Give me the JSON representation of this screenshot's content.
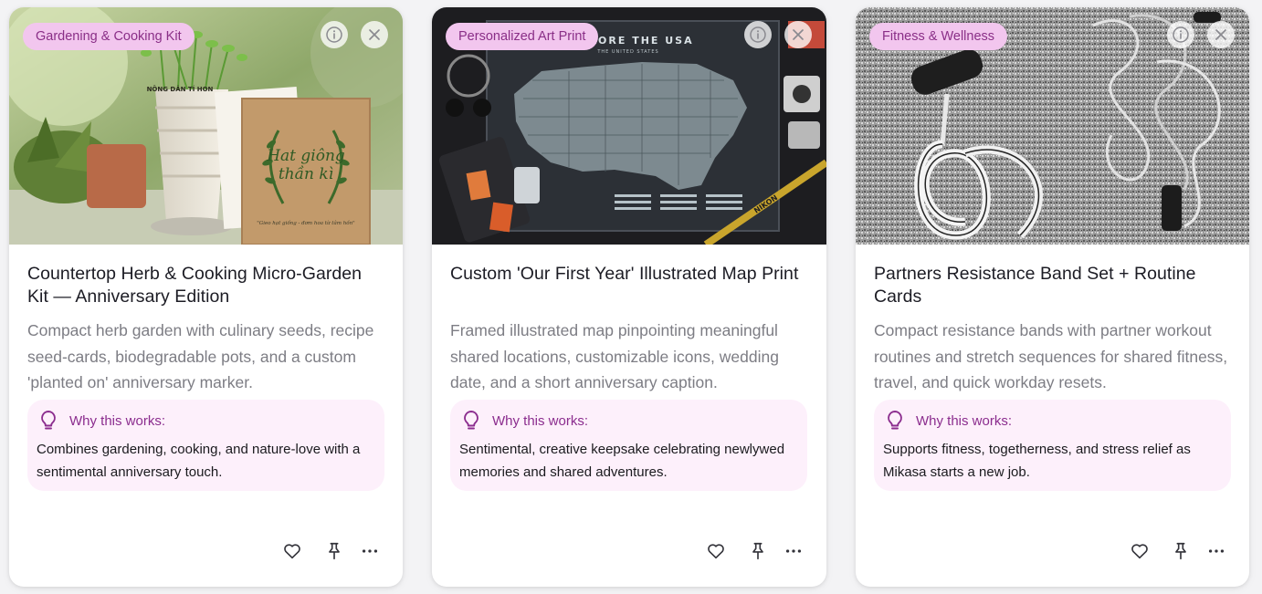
{
  "cards": [
    {
      "tag": "Gardening & Cooking Kit",
      "title": "Countertop Herb & Cooking Micro-Garden Kit — Anniversary Edition",
      "description": "Compact herb garden with culinary seeds, recipe seed-cards, biodegradable pots, and a custom 'planted on' anniversary marker.",
      "why_label": "Why this works:",
      "why_text": "Combines gardening, cooking, and nature-love with a sentimental anniversary touch.",
      "image_text": {
        "pot_label": "NÔNG DÂN TÍ HON",
        "packet_title_1": "Hat giông",
        "packet_title_2": "thần kì",
        "packet_caption": "\"Gieo hạt giống - đơm hoa từ tâm hồn\""
      }
    },
    {
      "tag": "Personalized Art Print",
      "title": "Custom 'Our First Year' Illustrated Map Print",
      "description": "Framed illustrated map pinpointing meaningful shared locations, customizable icons, wedding date, and a short anniversary caption.",
      "why_label": "Why this works:",
      "why_text": "Sentimental, creative keepsake celebrating newlywed memories and shared adventures.",
      "image_text": {
        "map_title": "EXPLORE THE USA",
        "map_subtitle": "THE UNITED STATES",
        "strap_text": "NIKON"
      }
    },
    {
      "tag": "Fitness & Wellness",
      "title": "Partners Resistance Band Set + Routine Cards",
      "description": "Compact resistance bands with partner workout routines and stretch sequences for shared fitness, travel, and quick workday resets.",
      "why_label": "Why this works:",
      "why_text": "Supports fitness, togetherness, and stress relief as Mikasa starts a new job.",
      "image_text": {}
    }
  ],
  "icons": {
    "info": "info-circle-icon",
    "close": "close-icon",
    "bulb": "lightbulb-icon",
    "like": "heart-icon",
    "pin": "pin-icon",
    "more": "more-horizontal-icon"
  },
  "colors": {
    "tag_bg": "#f2c6ee",
    "tag_text": "#8a2f87",
    "why_bg": "#fdf0fb",
    "accent": "#8b2d8e"
  }
}
